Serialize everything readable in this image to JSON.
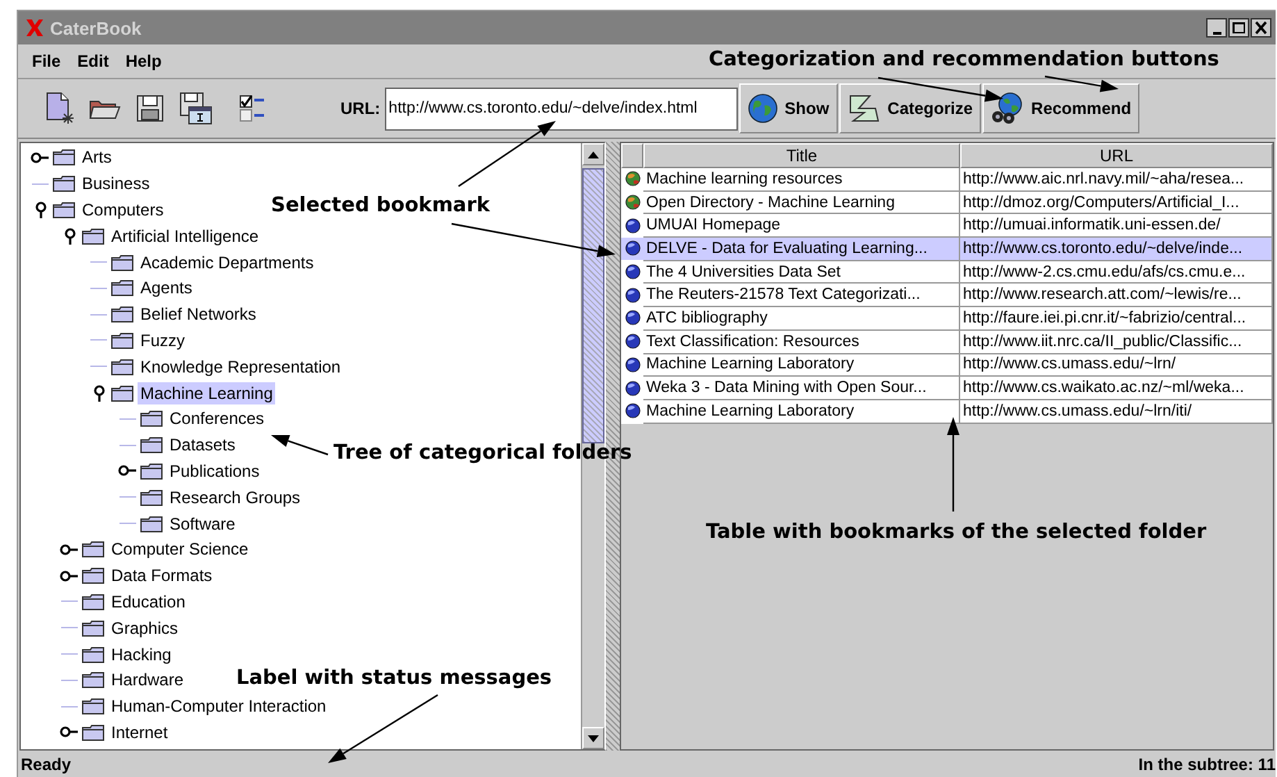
{
  "window": {
    "title": "CaterBook"
  },
  "menu": [
    "File",
    "Edit",
    "Help"
  ],
  "toolbar": {
    "url_label": "URL:",
    "url": "http://www.cs.toronto.edu/~delve/index.html",
    "buttons": [
      {
        "kind": "show",
        "label": "Show"
      },
      {
        "kind": "categorize",
        "label": "Categorize"
      },
      {
        "kind": "recommend",
        "label": "Recommend"
      }
    ]
  },
  "tree": [
    {
      "label": "Arts",
      "kind": "branch",
      "expanded": false,
      "selected": false
    },
    {
      "label": "Business",
      "kind": "leaf",
      "selected": false
    },
    {
      "label": "Computers",
      "kind": "branch",
      "expanded": true,
      "selected": false,
      "children": [
        {
          "label": "Artificial Intelligence",
          "kind": "branch",
          "expanded": true,
          "selected": false,
          "children": [
            {
              "label": "Academic Departments",
              "kind": "leaf",
              "selected": false
            },
            {
              "label": "Agents",
              "kind": "leaf",
              "selected": false
            },
            {
              "label": "Belief Networks",
              "kind": "leaf",
              "selected": false
            },
            {
              "label": "Fuzzy",
              "kind": "leaf",
              "selected": false
            },
            {
              "label": "Knowledge Representation",
              "kind": "leaf",
              "selected": false
            },
            {
              "label": "Machine Learning",
              "kind": "branch",
              "expanded": true,
              "selected": true,
              "children": [
                {
                  "label": "Conferences",
                  "kind": "leaf",
                  "selected": false
                },
                {
                  "label": "Datasets",
                  "kind": "leaf",
                  "selected": false
                },
                {
                  "label": "Publications",
                  "kind": "branch",
                  "expanded": false,
                  "selected": false
                },
                {
                  "label": "Research Groups",
                  "kind": "leaf",
                  "selected": false
                },
                {
                  "label": "Software",
                  "kind": "leaf",
                  "selected": false
                }
              ]
            }
          ]
        },
        {
          "label": "Computer Science",
          "kind": "branch",
          "expanded": false,
          "selected": false
        },
        {
          "label": "Data Formats",
          "kind": "branch",
          "expanded": false,
          "selected": false
        },
        {
          "label": "Education",
          "kind": "leaf",
          "selected": false
        },
        {
          "label": "Graphics",
          "kind": "leaf",
          "selected": false
        },
        {
          "label": "Hacking",
          "kind": "leaf",
          "selected": false
        },
        {
          "label": "Hardware",
          "kind": "leaf",
          "selected": false
        },
        {
          "label": "Human-Computer Interaction",
          "kind": "leaf",
          "selected": false
        },
        {
          "label": "Internet",
          "kind": "branch",
          "expanded": false,
          "selected": false
        }
      ]
    }
  ],
  "table": {
    "columns": [
      "Title",
      "URL"
    ],
    "rows": [
      {
        "kind": "colored",
        "title": "Machine learning resources",
        "url": "http://www.aic.nrl.navy.mil/~aha/resea...",
        "selected": false
      },
      {
        "kind": "colored",
        "title": "Open Directory - Machine Learning",
        "url": "http://dmoz.org/Computers/Artificial_I...",
        "selected": false
      },
      {
        "kind": "plain",
        "title": "UMUAI Homepage",
        "url": "http://umuai.informatik.uni-essen.de/",
        "selected": false
      },
      {
        "kind": "plain",
        "title": "DELVE - Data for Evaluating Learning...",
        "url": "http://www.cs.toronto.edu/~delve/inde...",
        "selected": true
      },
      {
        "kind": "plain",
        "title": "The 4 Universities Data Set",
        "url": "http://www-2.cs.cmu.edu/afs/cs.cmu.e...",
        "selected": false
      },
      {
        "kind": "plain",
        "title": "The Reuters-21578 Text Categorizati...",
        "url": "http://www.research.att.com/~lewis/re...",
        "selected": false
      },
      {
        "kind": "plain",
        "title": "ATC bibliography",
        "url": "http://faure.iei.pi.cnr.it/~fabrizio/central...",
        "selected": false
      },
      {
        "kind": "plain",
        "title": "Text Classification: Resources",
        "url": "http://www.iit.nrc.ca/II_public/Classific...",
        "selected": false
      },
      {
        "kind": "plain",
        "title": "Machine Learning Laboratory",
        "url": "http://www.cs.umass.edu/~lrn/",
        "selected": false
      },
      {
        "kind": "plain",
        "title": "Weka 3 - Data Mining with Open Sour...",
        "url": "http://www.cs.waikato.ac.nz/~ml/weka...",
        "selected": false
      },
      {
        "kind": "plain",
        "title": "Machine Learning Laboratory",
        "url": "http://www.cs.umass.edu/~lrn/iti/",
        "selected": false
      }
    ]
  },
  "status_bar": {
    "message": "Ready",
    "count": "In the subtree: 11"
  },
  "annotations": [
    {
      "text": "Categorization and recommendation buttons"
    },
    {
      "text": "Selected bookmark"
    },
    {
      "text": "Tree of categorical folders"
    },
    {
      "text": "Table with bookmarks of the selected folder"
    },
    {
      "text": "Label with status messages"
    }
  ]
}
